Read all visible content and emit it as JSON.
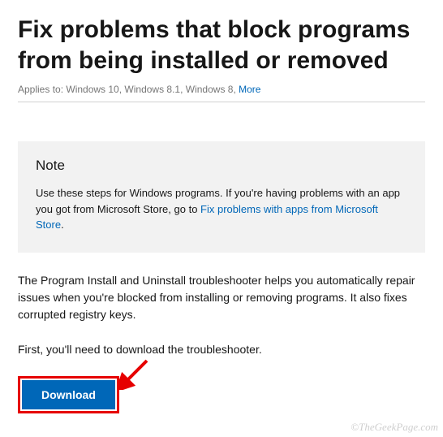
{
  "header": {
    "title": "Fix problems that block programs from being installed or removed",
    "applies_label": "Applies to: Windows 10, Windows 8.1, Windows 8, ",
    "more": "More"
  },
  "note": {
    "heading": "Note",
    "lead": "Use these steps for Windows programs. If you're having problems with an app you got from Microsoft Store, go to ",
    "link": "Fix problems with apps from Microsoft Store",
    "tail": "."
  },
  "body": {
    "para1": "The Program Install and Uninstall troubleshooter helps you automatically repair issues when you're blocked from installing or removing programs. It also fixes corrupted registry keys.",
    "para2": "First, you'll need to download the troubleshooter."
  },
  "actions": {
    "download": "Download"
  },
  "watermark": "©TheGeekPage.com"
}
